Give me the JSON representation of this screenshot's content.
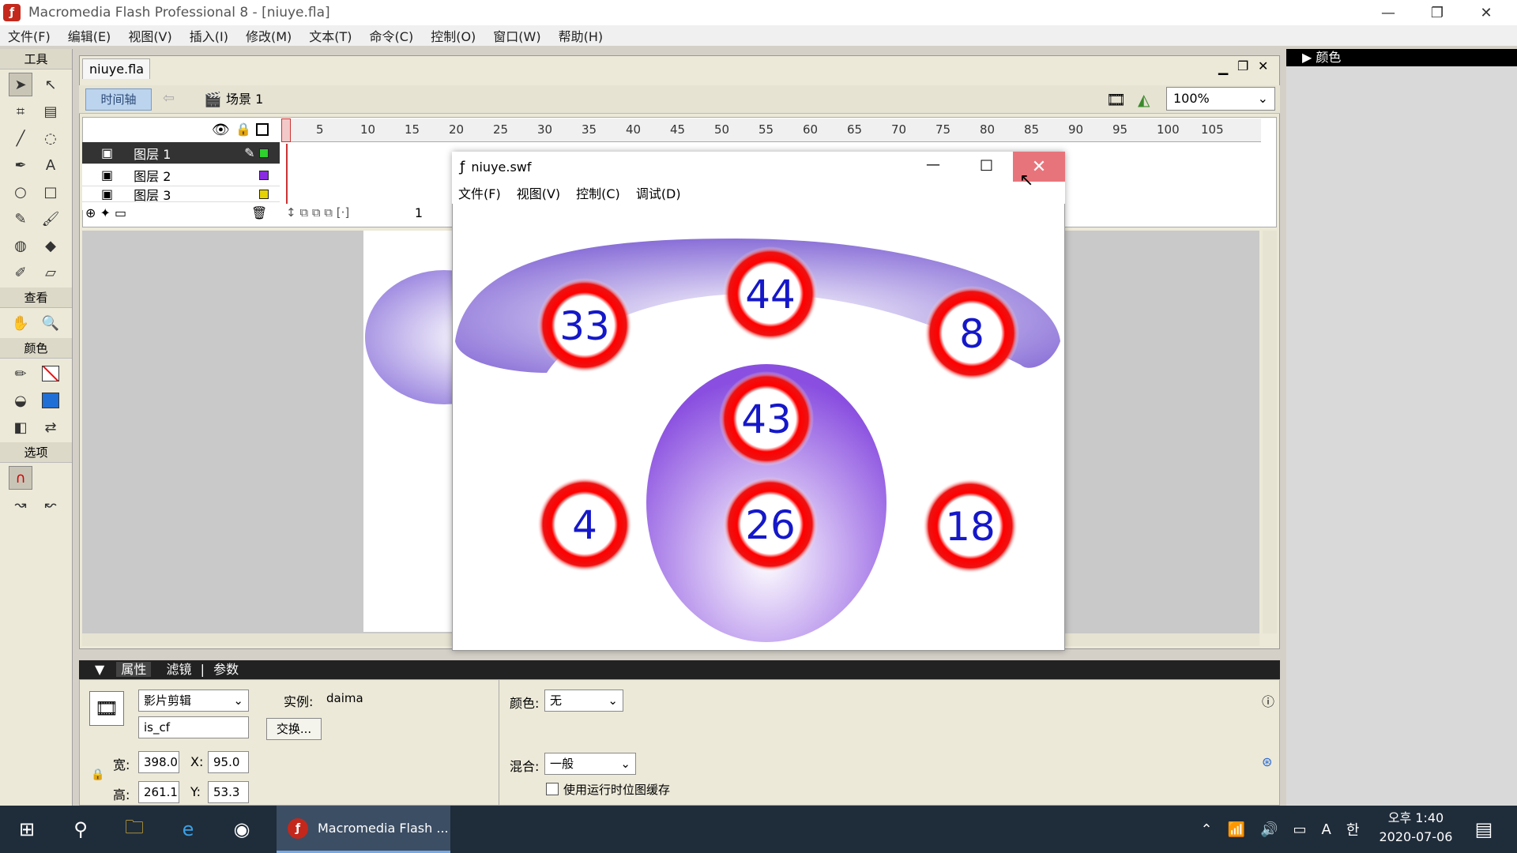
{
  "window": {
    "title": "Macromedia Flash Professional 8 - [niuye.fla]"
  },
  "menu": [
    "文件(F)",
    "编辑(E)",
    "视图(V)",
    "插入(I)",
    "修改(M)",
    "文本(T)",
    "命令(C)",
    "控制(O)",
    "窗口(W)",
    "帮助(H)"
  ],
  "tools": {
    "header": "工具",
    "view_label": "查看",
    "colors_label": "颜色",
    "options_label": "选项"
  },
  "document": {
    "tab": "niuye.fla",
    "timeline_button": "时间轴",
    "scene": "场景 1",
    "zoom": "100%"
  },
  "timeline": {
    "ruler": [
      "5",
      "10",
      "15",
      "20",
      "25",
      "30",
      "35",
      "40",
      "45",
      "50",
      "55",
      "60",
      "65",
      "70",
      "75",
      "80",
      "85",
      "90",
      "95",
      "100",
      "105"
    ],
    "layers": [
      {
        "name": "图层 1",
        "color": "#2ed12e"
      },
      {
        "name": "图层 2",
        "color": "#8a2be2"
      },
      {
        "name": "图层 3",
        "color": "#e6d200"
      }
    ],
    "current_frame": "1"
  },
  "swf": {
    "title": "niuye.swf",
    "menu": [
      "文件(F)",
      "视图(V)",
      "控制(C)",
      "调试(D)"
    ],
    "balls": [
      "33",
      "44",
      "8",
      "43",
      "4",
      "26",
      "18"
    ]
  },
  "colorpanel": {
    "title": "颜色"
  },
  "properties": {
    "tabs": [
      "属性",
      "滤镜",
      "参数"
    ],
    "symbol_type": "影片剪辑",
    "instance_label": "实例:",
    "instance_name": "daima",
    "name_value": "is_cf",
    "swap_button": "交换...",
    "color_label": "颜色:",
    "color_value": "无",
    "blend_label": "混合:",
    "blend_value": "一般",
    "cache_label": "使用运行时位图缓存",
    "width_label": "宽:",
    "width": "398.0",
    "height_label": "高:",
    "height": "261.1",
    "x_label": "X:",
    "x": "95.0",
    "y_label": "Y:",
    "y": "53.3"
  },
  "taskbar": {
    "app_label": "Macromedia Flash ...",
    "time": "오후 1:40",
    "date": "2020-07-06",
    "ime": "A",
    "lang": "한"
  }
}
